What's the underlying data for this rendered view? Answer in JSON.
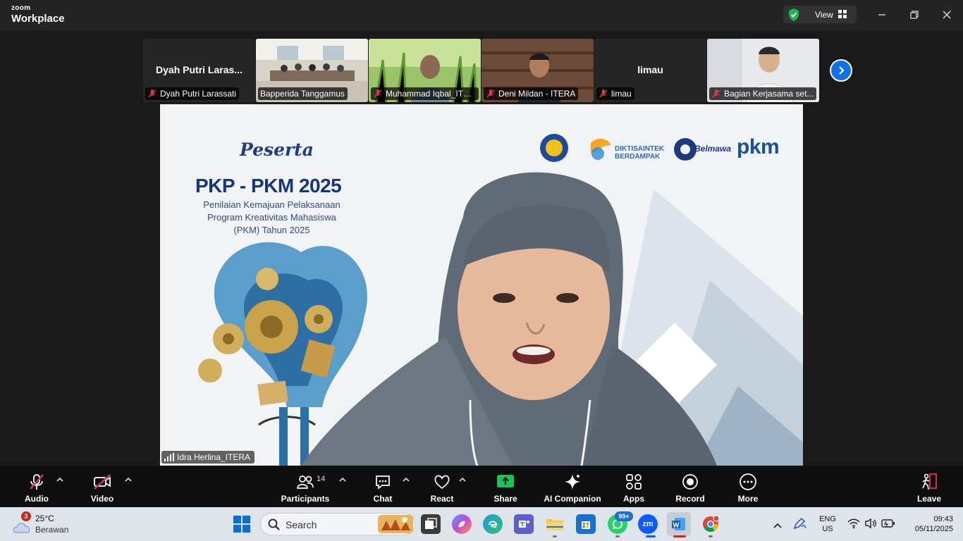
{
  "titlebar": {
    "brand_top": "zoom",
    "brand_bottom": "Workplace",
    "view_label": "View"
  },
  "strip": {
    "tiles": [
      {
        "big_name": "Dyah Putri Laras...",
        "label": "Dyah Putri Larassati",
        "type": "name"
      },
      {
        "big_name": "",
        "label": "Bapperida Tanggamus",
        "type": "video"
      },
      {
        "big_name": "",
        "label": "Muhammad Iqbal_ITE...",
        "type": "video"
      },
      {
        "big_name": "",
        "label": "Deni Mildan - ITERA",
        "type": "video"
      },
      {
        "big_name": "limau",
        "label": "limau",
        "type": "name"
      },
      {
        "big_name": "",
        "label": "Bagian Kerjasama set...",
        "type": "video"
      }
    ]
  },
  "slide": {
    "peserta": "Peserta",
    "title": "PKP - PKM 2025",
    "sub1": "Penilaian Kemajuan Pelaksanaan",
    "sub2": "Program Kreativitas Mahasiswa",
    "sub3": "(PKM) Tahun 2025",
    "logo_dikti_1": "DIKTISAINTEK",
    "logo_dikti_2": "BERDAMPAK",
    "logo_belmawa": "Belmawa",
    "logo_pkm": "pkm"
  },
  "speaker": {
    "name": "Idra Herlina_ITERA"
  },
  "toolbar": {
    "audio": "Audio",
    "video": "Video",
    "participants": "Participants",
    "participants_count": "14",
    "chat": "Chat",
    "react": "React",
    "share": "Share",
    "ai": "AI Companion",
    "apps": "Apps",
    "record": "Record",
    "more": "More",
    "leave": "Leave"
  },
  "taskbar": {
    "weather_badge": "3",
    "temp": "25°C",
    "weather_desc": "Berawan",
    "search": "Search",
    "whatsapp_badge": "99+",
    "zoom_app": "zm",
    "lang1": "ENG",
    "lang2": "US",
    "time": "09:43",
    "date": "05/11/2025"
  },
  "colors": {
    "accent": "#0e71eb",
    "share_green": "#17c65a",
    "muted_red": "#e0354f",
    "leave_red": "#e0354f"
  }
}
